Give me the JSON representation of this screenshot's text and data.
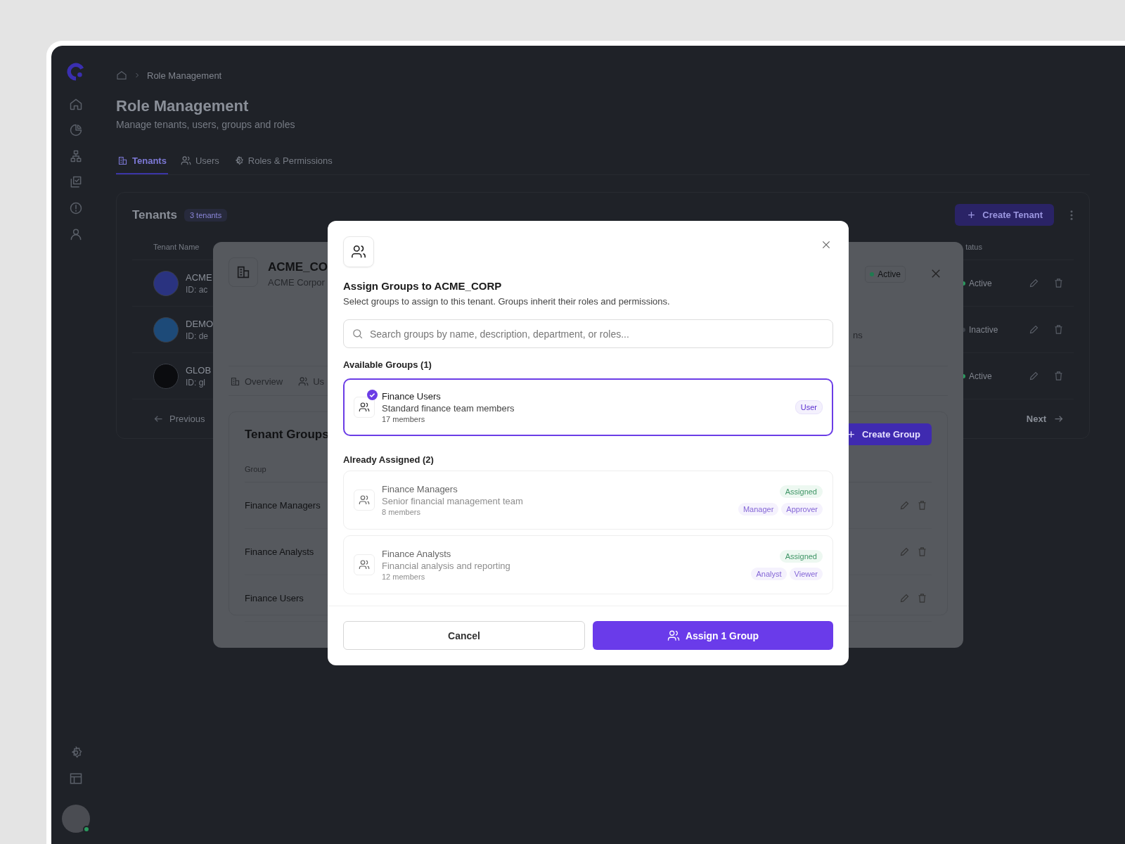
{
  "breadcrumb": {
    "current": "Role Management"
  },
  "page": {
    "title": "Role Management",
    "subtitle": "Manage tenants, users, groups and roles"
  },
  "tabs": [
    {
      "label": "Tenants",
      "selected": true
    },
    {
      "label": "Users",
      "selected": false
    },
    {
      "label": "Roles & Permissions",
      "selected": false
    }
  ],
  "tenants_card": {
    "title": "Tenants",
    "count": "3 tenants",
    "create_button": "Create Tenant",
    "columns": [
      "Tenant Name",
      "tatus"
    ],
    "rows": [
      {
        "name": "ACME",
        "id": "ID: ac",
        "color": "#2a3380",
        "status": "Active",
        "active": true
      },
      {
        "name": "DEMO",
        "id": "ID: de",
        "color": "#1d4a78",
        "status": "Inactive",
        "active": false
      },
      {
        "name": "GLOB",
        "id": "ID: gl",
        "color": "#0b0c0f",
        "status": "Active",
        "active": true
      }
    ],
    "previous": "Previous",
    "next": "Next"
  },
  "tenant_panel": {
    "name": "ACME_CO",
    "full_name": "ACME Corpor",
    "status": "Active",
    "fragment": "ns",
    "tabs": [
      {
        "label": "Overview",
        "selected": false
      },
      {
        "label": "Us",
        "selected": false
      }
    ],
    "groups_card": {
      "title": "Tenant Groups",
      "create_button": "Create Group",
      "column": "Group",
      "rows": [
        "Finance Managers",
        "Finance Analysts",
        "Finance Users"
      ]
    }
  },
  "modal": {
    "title": "Assign Groups to ACME_CORP",
    "description": "Select groups to assign to this tenant. Groups inherit their roles and permissions.",
    "search_placeholder": "Search groups by name, description, department, or roles...",
    "available_heading": "Available Groups (1)",
    "available": [
      {
        "name": "Finance Users",
        "description": "Standard finance team members",
        "members": "17 members",
        "roles": [
          "User"
        ],
        "selected": true
      }
    ],
    "assigned_heading": "Already Assigned (2)",
    "assigned": [
      {
        "name": "Finance Managers",
        "description": "Senior financial management team",
        "members": "8 members",
        "status": "Assigned",
        "roles": [
          "Manager",
          "Approver"
        ]
      },
      {
        "name": "Finance Analysts",
        "description": "Financial analysis and reporting",
        "members": "12 members",
        "status": "Assigned",
        "roles": [
          "Analyst",
          "Viewer"
        ]
      }
    ],
    "cancel": "Cancel",
    "submit": "Assign 1 Group"
  }
}
